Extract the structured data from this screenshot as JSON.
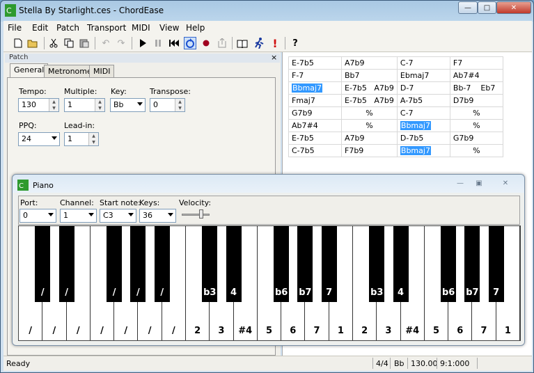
{
  "window": {
    "title": "Stella By Starlight.ces - ChordEase",
    "min_glyph": "—",
    "max_glyph": "□",
    "close_glyph": "✕"
  },
  "menu": [
    "File",
    "Edit",
    "Patch",
    "Transport",
    "MIDI",
    "View",
    "Help"
  ],
  "patch": {
    "header": "Patch",
    "close_glyph": "×",
    "tabs": [
      "General",
      "Metronome",
      "MIDI"
    ],
    "tempo": {
      "label": "Tempo:",
      "value": "130"
    },
    "multiple": {
      "label": "Multiple:",
      "value": "1"
    },
    "key": {
      "label": "Key:",
      "value": "Bb"
    },
    "transpose": {
      "label": "Transpose:",
      "value": "0"
    },
    "ppq": {
      "label": "PPQ:",
      "value": "24"
    },
    "leadin": {
      "label": "Lead-in:",
      "value": "1"
    }
  },
  "chords": [
    [
      "E-7b5",
      "A7b9",
      "C-7",
      "F7"
    ],
    [
      "F-7",
      "Bb7",
      "Ebmaj7",
      "Ab7#4"
    ],
    [
      "Bbmaj7",
      "E-7b5   A7b9",
      "D-7",
      "Bb-7    Eb7"
    ],
    [
      "Fmaj7",
      "E-7b5   A7b9",
      "A-7b5",
      "D7b9"
    ],
    [
      "G7b9",
      "%",
      "C-7",
      "%"
    ],
    [
      "Ab7#4",
      "%",
      "Bbmaj7",
      "%"
    ],
    [
      "E-7b5",
      "A7b9",
      "D-7b5",
      "G7b9"
    ],
    [
      "C-7b5",
      "F7b9",
      "Bbmaj7",
      "%"
    ]
  ],
  "selected_chord": "Bbmaj7",
  "piano": {
    "title": "Piano",
    "port": {
      "label": "Port:",
      "value": "0"
    },
    "channel": {
      "label": "Channel:",
      "value": "1"
    },
    "start_note": {
      "label": "Start note:",
      "value": "C3"
    },
    "keys": {
      "label": "Keys:",
      "value": "36"
    },
    "velocity": {
      "label": "Velocity:",
      "level": 0.7
    },
    "white_labels": [
      "/",
      "/",
      "/",
      "/",
      "/",
      "/",
      "/",
      "2",
      "3",
      "#4",
      "5",
      "6",
      "7",
      "1",
      "2",
      "3",
      "#4",
      "5",
      "6",
      "7",
      "1"
    ],
    "black_labels": [
      "/",
      "/",
      "/",
      "/",
      "/",
      "b3",
      "4",
      "b6",
      "b7",
      "7",
      "b3",
      "4",
      "b6",
      "b7",
      "7"
    ]
  },
  "status": {
    "text": "Ready",
    "meter": "4/4",
    "key": "Bb",
    "tempo": "130.00",
    "position": "9:1:000"
  }
}
